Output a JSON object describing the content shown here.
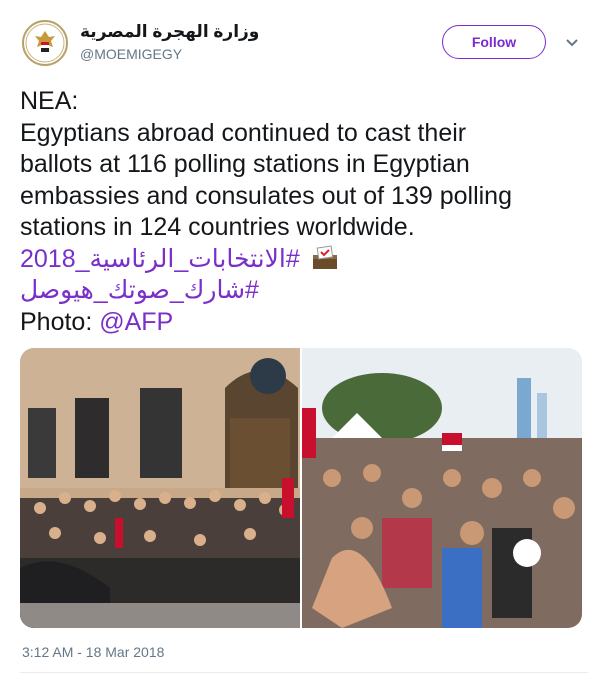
{
  "user": {
    "display_name": "وزارة الهجرة المصرية",
    "handle": "@MOEMIGEGY",
    "avatar_icon": "egypt-eagle-emblem"
  },
  "actions": {
    "follow_label": "Follow",
    "menu_icon": "chevron-down-icon"
  },
  "tweet": {
    "line1": "NEA:",
    "line2": "Egyptians abroad continued to cast their",
    "line3": "ballots at 116 polling stations in Egyptian",
    "line4": "embassies and consulates out of 139 polling",
    "line5": "stations in 124 countries worldwide.",
    "hashtag1": "#الانتخابات_الرئاسية_2018",
    "hashtag1_emoji": "ballot-box-icon",
    "hashtag2": "#شارك_صوتك_هيوصل",
    "photo_prefix": "Photo: ",
    "photo_mention": "@AFP"
  },
  "media": {
    "photo_left": "crowd-outside-embassy-photo",
    "photo_right": "crowd-with-flags-photo"
  },
  "meta": {
    "timestamp": "3:12 AM - 18 Mar 2018"
  },
  "colors": {
    "accent": "#7b2fc9",
    "text": "#14171a",
    "secondary": "#657786"
  }
}
